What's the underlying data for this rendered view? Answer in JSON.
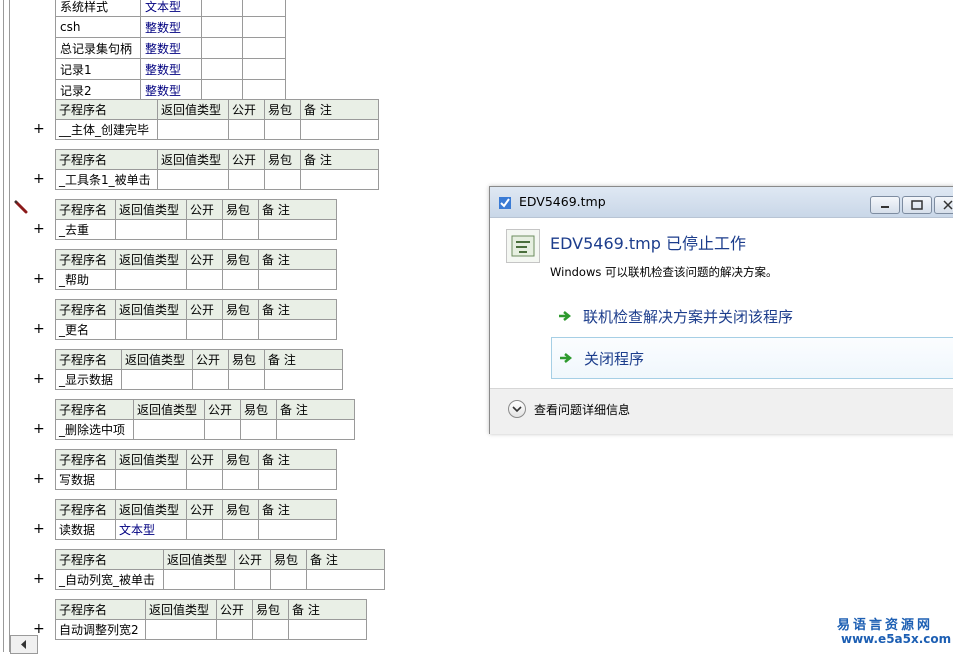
{
  "var_table": {
    "rows": [
      {
        "name": "系统样式",
        "type": "文本型"
      },
      {
        "name": "csh",
        "type": "整数型"
      },
      {
        "name": "总记录集句柄",
        "type": "整数型"
      },
      {
        "name": "记录1",
        "type": "整数型"
      },
      {
        "name": "记录2",
        "type": "整数型"
      }
    ]
  },
  "subprograms": {
    "headers": {
      "name": "子程序名",
      "return_type": "返回值类型",
      "public": "公开",
      "easy_pack": "易包",
      "note": "备 注"
    },
    "items": [
      {
        "name": "__主体_创建完毕",
        "return_type": ""
      },
      {
        "name": "_工具条1_被单击",
        "return_type": ""
      },
      {
        "name": "_去重",
        "return_type": ""
      },
      {
        "name": "_帮助",
        "return_type": ""
      },
      {
        "name": "_更名",
        "return_type": ""
      },
      {
        "name": "_显示数据",
        "return_type": ""
      },
      {
        "name": "_删除选中项",
        "return_type": ""
      },
      {
        "name": "写数据",
        "return_type": ""
      },
      {
        "name": "读数据",
        "return_type": "文本型"
      },
      {
        "name": "_自动列宽_被单击",
        "return_type": ""
      },
      {
        "name": "自动调整列宽2",
        "return_type": ""
      }
    ],
    "expand_glyph": "+"
  },
  "dialog": {
    "window_title": "EDV5469.tmp",
    "heading": "EDV5469.tmp 已停止工作",
    "description": "Windows 可以联机检查该问题的解决方案。",
    "option_check_online": "联机检查解决方案并关闭该程序",
    "option_close": "关闭程序",
    "details_label": "查看问题详细信息",
    "accent_color": "#1c3d8c"
  },
  "watermark": {
    "line1": "易语言资源网",
    "line2": "www.e5a5x.com"
  }
}
